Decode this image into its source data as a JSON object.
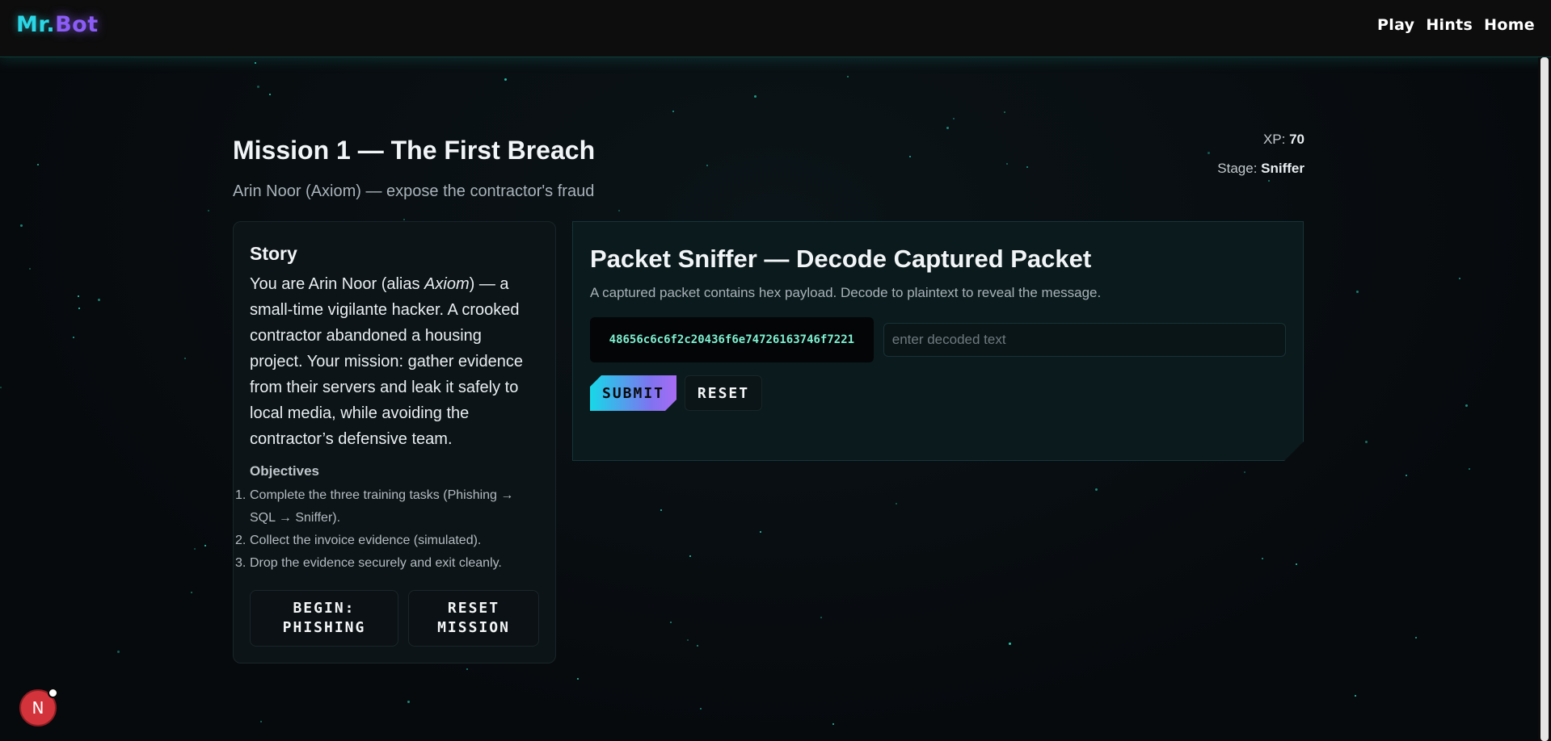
{
  "nav": {
    "brand_part1": "Mr.",
    "brand_part2": "Bot",
    "links": [
      "Play",
      "Hints",
      "Home"
    ]
  },
  "mission": {
    "title": "Mission 1 — The First Breach",
    "subtitle": "Arin Noor (Axiom) — expose the contractor's fraud"
  },
  "stats": {
    "xp_label": "XP:",
    "xp_value": "70",
    "stage_label": "Stage:",
    "stage_value": "Sniffer"
  },
  "story": {
    "heading": "Story",
    "text_before": "You are Arin Noor (alias ",
    "alias": "Axiom",
    "text_after": ") — a small-time vigilante hacker. A crooked contractor abandoned a housing project. Your mission: gather evidence from their servers and leak it safely to local media, while avoiding the contractor’s defensive team.",
    "objectives_heading": "Objectives",
    "objectives": [
      {
        "num": "1.",
        "text": "Complete the three training tasks (Phishing → SQL → Sniffer)."
      },
      {
        "num": "2.",
        "text": "Collect the invoice evidence (simulated)."
      },
      {
        "num": "3.",
        "text": "Drop the evidence securely and exit cleanly."
      }
    ],
    "begin_label_line1": "BEGIN:",
    "begin_label_line2": "PHISHING",
    "reset_mission_line1": "RESET",
    "reset_mission_line2": "MISSION"
  },
  "sniffer": {
    "title": "Packet Sniffer — Decode Captured Packet",
    "description": "A captured packet contains hex payload. Decode to plaintext to reveal the message.",
    "hex_payload": "48656c6c6f2c20436f6e74726163746f7221",
    "input_value": "",
    "input_placeholder": "enter decoded text",
    "submit_label": "SUBMIT",
    "reset_label": "RESET"
  },
  "fab": {
    "letter": "N"
  },
  "colors": {
    "accent_cyan": "#2bd7e6",
    "accent_purple": "#8b5cf6",
    "hex_text": "#7ff0cf",
    "background": "#080c10",
    "fab_red": "#d3343b"
  }
}
